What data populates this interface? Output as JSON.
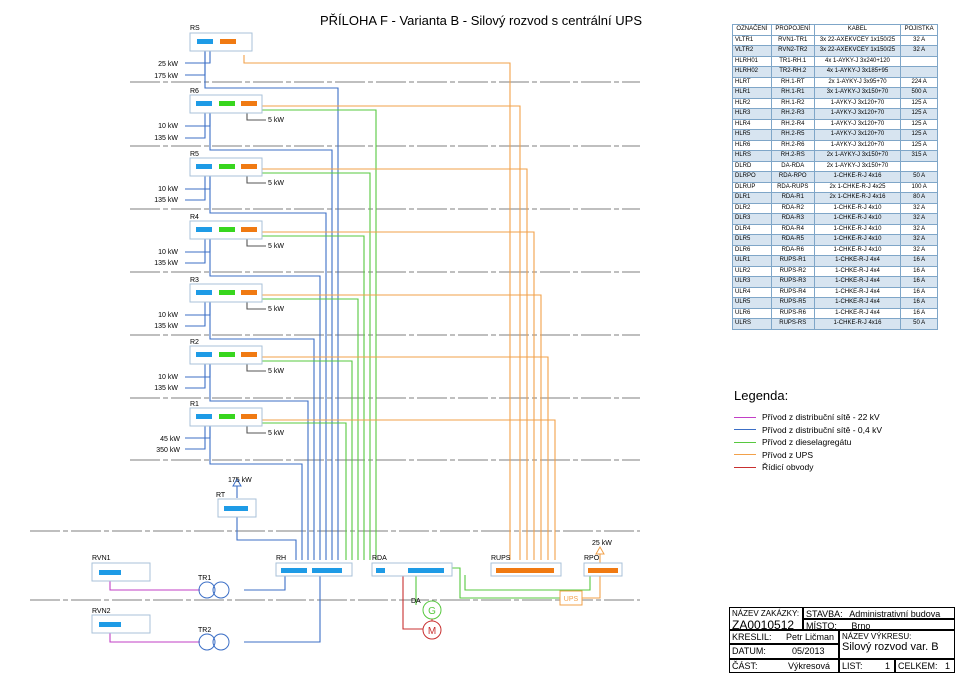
{
  "title": "PŘÍLOHA F - Varianta B - Silový rozvod s centrální UPS",
  "boards": [
    {
      "id": "RS",
      "label": "RS"
    },
    {
      "id": "R6",
      "label": "R6",
      "load_label": "5 kW",
      "in_upper": "10 kW",
      "in_lower": "135 kW"
    },
    {
      "id": "R5",
      "label": "R5",
      "load_label": "5 kW",
      "in_upper": "10 kW",
      "in_lower": "135 kW"
    },
    {
      "id": "R4",
      "label": "R4",
      "load_label": "5 kW",
      "in_upper": "10 kW",
      "in_lower": "135 kW"
    },
    {
      "id": "R3",
      "label": "R3",
      "load_label": "5 kW",
      "in_upper": "10 kW",
      "in_lower": "135 kW"
    },
    {
      "id": "R2",
      "label": "R2",
      "load_label": "5 kW",
      "in_upper": "10 kW",
      "in_lower": "135 kW"
    },
    {
      "id": "R1",
      "label": "R1",
      "load_label": "5 kW",
      "in_upper": "45 kW",
      "in_lower": "350 kW"
    }
  ],
  "rs_inputs": {
    "upper": "25 kW",
    "lower": "175 kW"
  },
  "devices": {
    "rt": {
      "label": "RT",
      "power": "175 kW"
    },
    "rvn1": "RVN1",
    "rvn2": "RVN2",
    "tr1": "TR1",
    "tr2": "TR2",
    "rh": "RH",
    "rda": "RDA",
    "rups": "RUPS",
    "rpo": {
      "label": "RPO",
      "power": "25 kW"
    },
    "da": "DA",
    "generator": "G",
    "motor": "M",
    "ups": "UPS"
  },
  "cable_table": {
    "headers": [
      "OZNAČENÍ",
      "PROPOJENÍ",
      "KABEL",
      "POJISTKA"
    ],
    "rows": [
      [
        "VLTR1",
        "RVN1-TR1",
        "3x 22-AXEKVCEY 1x150/25",
        "32 A"
      ],
      [
        "VLTR2",
        "RVN2-TR2",
        "3x 22-AXEKVCEY 1x150/25",
        "32 A"
      ],
      [
        "HLRH01",
        "TR1-RH.1",
        "4x 1-AYKY-J 3x240+120",
        ""
      ],
      [
        "HLRH02",
        "TR2-RH.2",
        "4x 1-AYKY-J 3x185+95",
        ""
      ],
      [
        "HLRT",
        "RH.1-RT",
        "2x 1-AYKY-J 3x95+70",
        "224 A"
      ],
      [
        "HLR1",
        "RH.1-R1",
        "3x 1-AYKY-J 3x150+70",
        "500 A"
      ],
      [
        "HLR2",
        "RH.1-R2",
        "1-AYKY-J 3x120+70",
        "125 A"
      ],
      [
        "HLR3",
        "RH.2-R3",
        "1-AYKY-J 3x120+70",
        "125 A"
      ],
      [
        "HLR4",
        "RH.2-R4",
        "1-AYKY-J 3x120+70",
        "125 A"
      ],
      [
        "HLR5",
        "RH.2-R5",
        "1-AYKY-J 3x120+70",
        "125 A"
      ],
      [
        "HLR6",
        "RH.2-R6",
        "1-AYKY-J 3x120+70",
        "125 A"
      ],
      [
        "HLRS",
        "RH.2-RS",
        "2x 1-AYKY-J 3x150+70",
        "315 A"
      ],
      [
        "DLRD",
        "DA-RDA",
        "2x 1-AYKY-J 3x150+70",
        ""
      ],
      [
        "DLRPO",
        "RDA-RPO",
        "1-CHKE-R-J 4x16",
        "50 A"
      ],
      [
        "DLRUP",
        "RDA-RUPS",
        "2x 1-CHKE-R-J 4x25",
        "100 A"
      ],
      [
        "DLR1",
        "RDA-R1",
        "2x 1-CHKE-R-J 4x16",
        "80 A"
      ],
      [
        "DLR2",
        "RDA-R2",
        "1-CHKE-R-J 4x10",
        "32 A"
      ],
      [
        "DLR3",
        "RDA-R3",
        "1-CHKE-R-J 4x10",
        "32 A"
      ],
      [
        "DLR4",
        "RDA-R4",
        "1-CHKE-R-J 4x10",
        "32 A"
      ],
      [
        "DLR5",
        "RDA-R5",
        "1-CHKE-R-J 4x10",
        "32 A"
      ],
      [
        "DLR6",
        "RDA-R6",
        "1-CHKE-R-J 4x10",
        "32 A"
      ],
      [
        "ULR1",
        "RUPS-R1",
        "1-CHKE-R-J 4x4",
        "16 A"
      ],
      [
        "ULR2",
        "RUPS-R2",
        "1-CHKE-R-J 4x4",
        "16 A"
      ],
      [
        "ULR3",
        "RUPS-R3",
        "1-CHKE-R-J 4x4",
        "16 A"
      ],
      [
        "ULR4",
        "RUPS-R4",
        "1-CHKE-R-J 4x4",
        "16 A"
      ],
      [
        "ULR5",
        "RUPS-R5",
        "1-CHKE-R-J 4x4",
        "16 A"
      ],
      [
        "ULR6",
        "RUPS-R6",
        "1-CHKE-R-J 4x4",
        "16 A"
      ],
      [
        "ULRS",
        "RUPS-RS",
        "1-CHKE-R-J 4x16",
        "50 A"
      ]
    ]
  },
  "legend": {
    "title": "Legenda:",
    "items": [
      {
        "label": "Přívod z distribuční sítě - 22 kV",
        "color": "#c23fc6"
      },
      {
        "label": "Přívod z distribuční sítě - 0,4 kV",
        "color": "#3c6fc6"
      },
      {
        "label": "Přívod z dieselagregátu",
        "color": "#57c83f"
      },
      {
        "label": "Přívod z UPS",
        "color": "#f2a14a"
      },
      {
        "label": "Řídicí obvody",
        "color": "#c83030"
      }
    ]
  },
  "title_block": {
    "zakazka_label": "NÁZEV ZAKÁZKY:",
    "zakazka_value": "ZA0010512",
    "stavba_label": "STAVBA:",
    "stavba_value": "Administrativní budova",
    "misto_label": "MÍSTO:",
    "misto_value": "Brno",
    "kreslil_label": "KRESLIL:",
    "kreslil_value": "Petr Ličman",
    "vykres_label": "NÁZEV VÝKRESU:",
    "vykres_value": "Silový rozvod var. B",
    "datum_label": "DATUM:",
    "datum_value": "05/2013",
    "cast_label": "ČÁST:",
    "cast_value": "Výkresová",
    "list_label": "LIST:",
    "list_value": "1",
    "celkem_label": "CELKEM:",
    "celkem_value": "1"
  },
  "colors": {
    "hv": "#c23fc6",
    "lv": "#3c6fc6",
    "diesel": "#57c83f",
    "ups": "#f2a14a",
    "control": "#c83030",
    "breaker_blue": "#1e9be6",
    "breaker_green": "#38d61e",
    "breaker_orange": "#f07a12"
  }
}
